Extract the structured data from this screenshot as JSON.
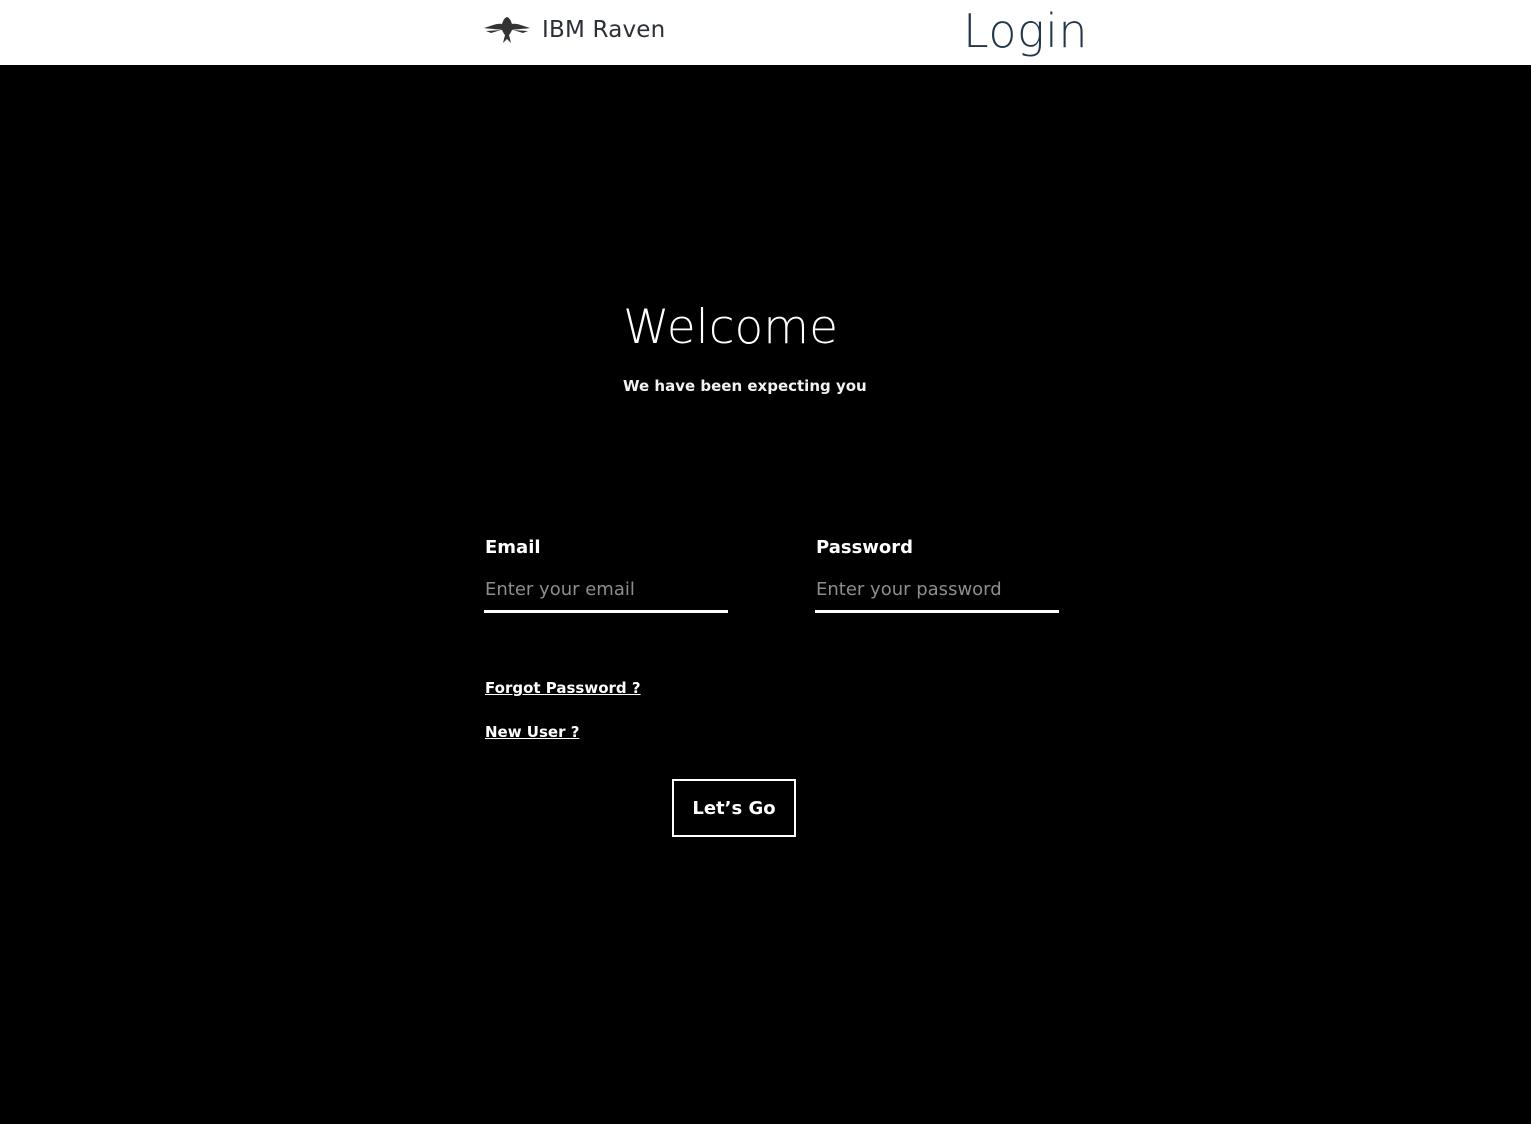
{
  "header": {
    "brand_name": "IBM Raven",
    "logo_icon": "raven-icon",
    "page_title": "Login"
  },
  "welcome": {
    "heading": "Welcome",
    "subheading": "We have been expecting you"
  },
  "form": {
    "email": {
      "label": "Email",
      "placeholder": "Enter your email",
      "value": ""
    },
    "password": {
      "label": "Password",
      "placeholder": "Enter your password",
      "value": ""
    },
    "forgot_password_link": "Forgot Password ?",
    "new_user_link": "New User ?",
    "submit_label": "Let’s Go"
  },
  "colors": {
    "background": "#000000",
    "header_background": "#ffffff",
    "text": "#ffffff",
    "title_text": "#24364a",
    "placeholder": "#8d8d8d"
  }
}
